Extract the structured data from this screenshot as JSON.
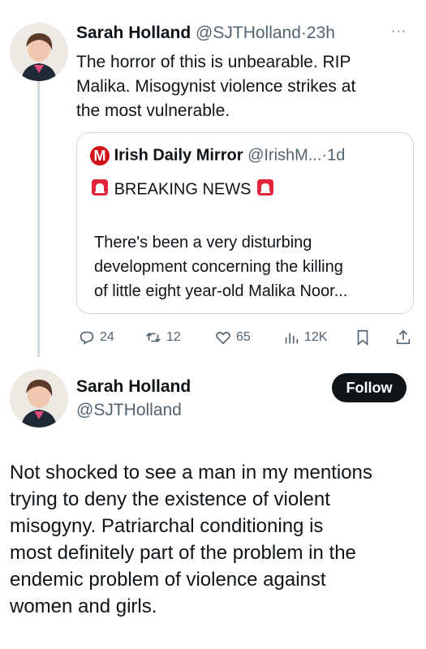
{
  "tweet1": {
    "author_name": "Sarah Holland",
    "handle": "@SJTHolland",
    "separator": "·",
    "time": "23h",
    "more": "···",
    "text_lines": [
      "The horror of this is unbearable.  RIP",
      "Malika. Misogynist violence strikes at",
      "the most vulnerable."
    ],
    "quote": {
      "logo_letter": "M",
      "source_name": "Irish Daily Mirror",
      "source_handle": "@IrishM...",
      "separator": "·",
      "time": "1d",
      "headline": "BREAKING NEWS",
      "body_lines": [
        "There's been a very disturbing",
        "development concerning the killing",
        "of little eight year-old Malika Noor..."
      ]
    },
    "actions": {
      "replies": "24",
      "reposts": "12",
      "likes": "65",
      "views": "12K"
    }
  },
  "tweet2": {
    "author_name": "Sarah Holland",
    "handle": "@SJTHolland",
    "follow_label": "Follow",
    "text_lines": [
      "Not shocked to see a man in my mentions",
      "trying to deny the existence of violent",
      "misogyny. Patriarchal conditioning is",
      "most definitely part of the problem in the",
      "endemic problem of violence against",
      "women and girls."
    ]
  },
  "colors": {
    "accent_dark": "#0f1419",
    "muted": "#536471",
    "border": "#cfd9de",
    "mirror_red": "#d1101a"
  },
  "icons": [
    "reply-icon",
    "repost-icon",
    "like-icon",
    "views-icon",
    "bookmark-icon",
    "share-icon",
    "siren-icon",
    "mirror-logo"
  ]
}
